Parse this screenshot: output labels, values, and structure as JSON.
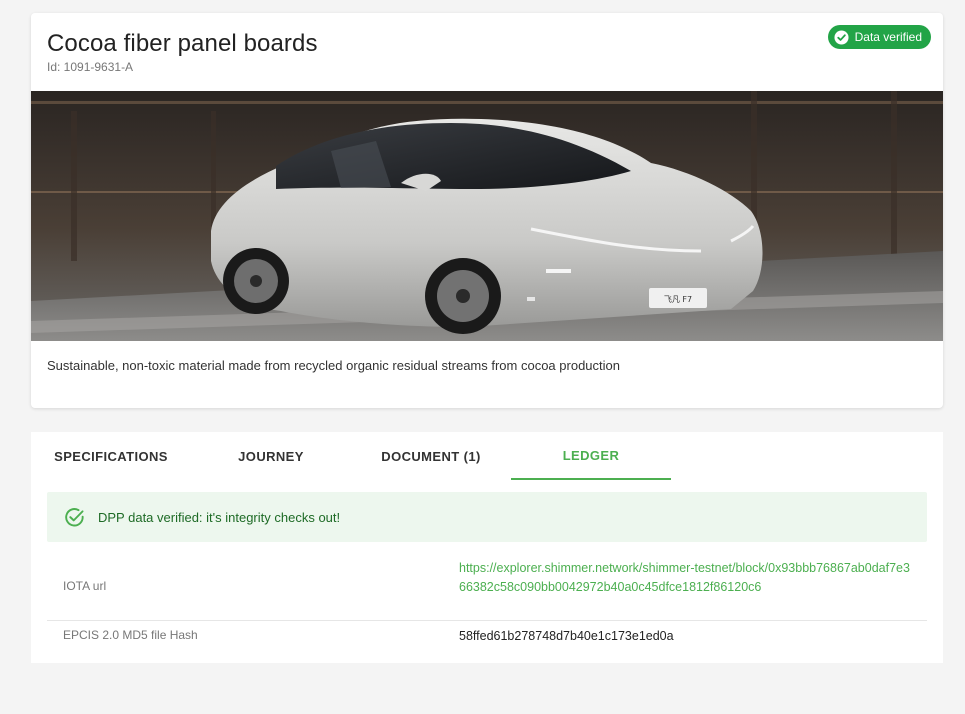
{
  "product": {
    "title": "Cocoa fiber panel boards",
    "id_label": "Id: 1091-9631-A",
    "description": "Sustainable, non-toxic material made from recycled organic residual streams from cocoa production"
  },
  "badge": {
    "label": "Data verified",
    "icon": "check-circle-icon",
    "color": "#22a447"
  },
  "hero_image": {
    "subject": "car-photo",
    "plate_text": "飞凡 F7"
  },
  "tabs": [
    {
      "label": "SPECIFICATIONS",
      "active": false
    },
    {
      "label": "JOURNEY",
      "active": false
    },
    {
      "label": "DOCUMENT (1)",
      "active": false
    },
    {
      "label": "LEDGER",
      "active": true
    }
  ],
  "accent_color": "#4caf50",
  "ledger": {
    "alert": {
      "text": "DPP data verified: it's integrity checks out!",
      "icon": "check-circle-outline-icon"
    },
    "rows": [
      {
        "label": "IOTA url",
        "value": "https://explorer.shimmer.network/shimmer-testnet/block/0x93bbb76867ab0daf7e366382c58c090bb0042972b40a0c45dfce1812f86120c6"
      },
      {
        "label": "EPCIS 2.0 MD5 file Hash",
        "value": "58ffed61b278748d7b40e1c173e1ed0a"
      }
    ]
  }
}
